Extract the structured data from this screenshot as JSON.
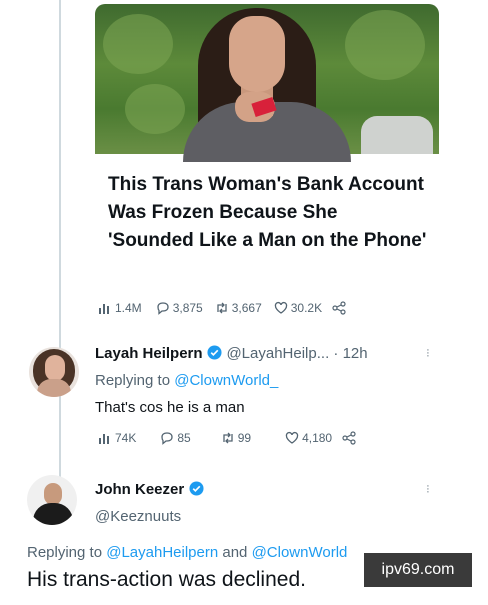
{
  "article": {
    "headline": "This Trans Woman's Bank Account Was Frozen Because She 'Sounded Like a Man on the Phone'"
  },
  "tweet_stats": {
    "views": "1.4M",
    "replies": "3,875",
    "retweets": "3,667",
    "likes": "30.2K"
  },
  "reply1": {
    "name": "Layah Heilpern",
    "handle_time": "@LayahHeilp... · 12h",
    "replying_prefix": "Replying to",
    "replying_to": "@ClownWorld_",
    "text": "That's cos he is a man",
    "stats": {
      "views": "74K",
      "replies": "85",
      "retweets": "99",
      "likes": "4,180"
    }
  },
  "reply2": {
    "name": "John Keezer",
    "handle": "@Keeznuuts",
    "replying_prefix": "Replying to",
    "replying_to_1": "@LayahHeilpern",
    "replying_and": "and",
    "replying_to_2": "@ClownWorld",
    "text": "His trans-action was declined."
  },
  "watermark": "ipv69.com",
  "colors": {
    "link": "#1d9bf0",
    "verified": "#1d9bf0",
    "muted": "#536471"
  },
  "icons": [
    "views-icon",
    "reply-icon",
    "retweet-icon",
    "like-icon",
    "share-icon",
    "verified-badge-icon",
    "more-icon"
  ]
}
